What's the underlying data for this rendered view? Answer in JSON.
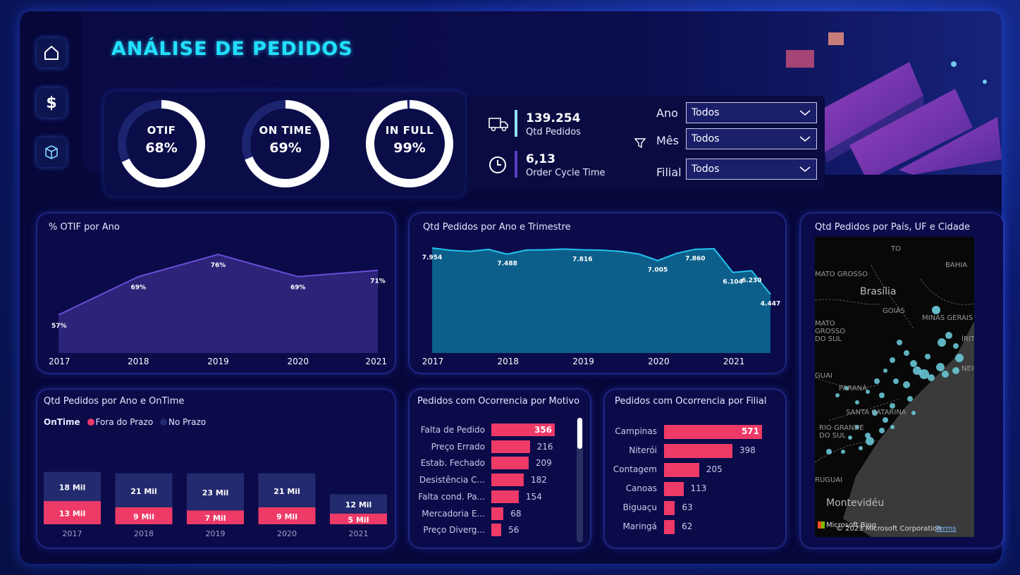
{
  "title": "ANÁLISE DE PEDIDOS",
  "nav": [
    {
      "icon": "home-icon"
    },
    {
      "icon": "dollar-icon"
    },
    {
      "icon": "box-icon"
    }
  ],
  "kpis": [
    {
      "label": "OTIF",
      "value": "68%",
      "percent": 68
    },
    {
      "label": "ON TIME",
      "value": "69%",
      "percent": 69
    },
    {
      "label": "IN FULL",
      "value": "99%",
      "percent": 99
    }
  ],
  "metrics": [
    {
      "value": "139.254",
      "label": "Qtd Pedidos",
      "icon": "truck-icon",
      "color": "#8fe3f5"
    },
    {
      "value": "6,13",
      "label": "Order Cycle Time",
      "icon": "clock-icon",
      "color": "#5a3fc4"
    }
  ],
  "filters": [
    {
      "label": "Ano",
      "value": "Todos"
    },
    {
      "label": "Mês",
      "value": "Todos"
    },
    {
      "label": "Filial",
      "value": "Todos"
    }
  ],
  "colors": {
    "accent": "#22e0ff",
    "pink": "#ee3a67",
    "navy_bar": "#232a6e",
    "purple": "#2c2478",
    "teal": "#0c5f8a"
  },
  "otif_chart": {
    "title": "% OTIF por Ano",
    "chart_data": {
      "type": "area",
      "x": [
        "2017",
        "2018",
        "2019",
        "2020",
        "2021"
      ],
      "values": [
        57,
        69,
        76,
        69,
        71
      ],
      "data_labels": [
        "57%",
        "69%",
        "76%",
        "69%",
        "71%"
      ],
      "ylim": [
        45,
        80
      ]
    }
  },
  "qtd_trimestre_chart": {
    "title": "Qtd Pedidos por Ano e Trimestre",
    "chart_data": {
      "type": "area",
      "x_ticks": [
        "2017",
        "2018",
        "2019",
        "2020",
        "2021"
      ],
      "values": [
        7954,
        7780,
        7700,
        7850,
        7488,
        7800,
        7820,
        7880,
        7816,
        7790,
        7700,
        7500,
        7005,
        7550,
        7860,
        7900,
        6104,
        6230,
        4447
      ],
      "labels": [
        {
          "i": 0,
          "text": "7.954"
        },
        {
          "i": 4,
          "text": "7.488"
        },
        {
          "i": 8,
          "text": "7.816"
        },
        {
          "i": 12,
          "text": "7.005"
        },
        {
          "i": 14,
          "text": "7.860"
        },
        {
          "i": 16,
          "text": "6.104"
        },
        {
          "i": 17,
          "text": "6.230"
        },
        {
          "i": 18,
          "text": "4.447"
        }
      ],
      "ylim": [
        0,
        9500
      ]
    }
  },
  "ontime_chart": {
    "title": "Qtd Pedidos por Ano e OnTime",
    "legend": {
      "title": "OnTime",
      "items": [
        {
          "name": "Fora do Prazo",
          "color": "#ee3a67"
        },
        {
          "name": "No Prazo",
          "color": "#232a6e"
        }
      ]
    },
    "chart_data": {
      "type": "bar",
      "categories": [
        "2017",
        "2018",
        "2019",
        "2020",
        "2021"
      ],
      "series": [
        {
          "name": "Fora do Prazo",
          "values": [
            13,
            9,
            7,
            9,
            5
          ],
          "labels": [
            "13 Mil",
            "9 Mil",
            "7 Mil",
            "9 Mil",
            "5 Mil"
          ]
        },
        {
          "name": "No Prazo",
          "values": [
            18,
            21,
            23,
            21,
            12
          ],
          "labels": [
            "18 Mil",
            "21 Mil",
            "23 Mil",
            "21 Mil",
            "12 Mil"
          ]
        }
      ],
      "stacked": true
    }
  },
  "motivo_chart": {
    "title": "Pedidos com Ocorrencia por Motivo",
    "chart_data": {
      "type": "bar",
      "orientation": "horizontal",
      "categories": [
        "Falta de Pedido",
        "Preço Errado",
        "Estab. Fechado",
        "Desistência C...",
        "Falta cond. Pa...",
        "Mercadoria E...",
        "Preço Diverg..."
      ],
      "values": [
        356,
        216,
        209,
        182,
        154,
        68,
        56
      ]
    }
  },
  "filial_chart": {
    "title": "Pedidos com Ocorrencia por Filial",
    "chart_data": {
      "type": "bar",
      "orientation": "horizontal",
      "categories": [
        "Campinas",
        "Niterói",
        "Contagem",
        "Canoas",
        "Biguaçu",
        "Maringá"
      ],
      "values": [
        571,
        398,
        205,
        113,
        63,
        62
      ]
    }
  },
  "map": {
    "title": "Qtd Pedidos por País, UF e Cidade",
    "labels": [
      "TO",
      "BAHIA",
      "MATO GROSSO",
      "Brasília",
      "GOIÁS",
      "MINAS GERAIS",
      "MATO GROSSO DO SUL",
      "PARANÁ",
      "SANTA CATARINA",
      "RIO GRANDE DO SUL",
      "Montevidéu",
      "GUAI",
      "RUGUAI",
      "ÍRITO",
      "NEIRO"
    ],
    "attribution": "© 2023 Microsoft Corporation",
    "terms": "Terms",
    "bing": "Microsoft Bing"
  }
}
